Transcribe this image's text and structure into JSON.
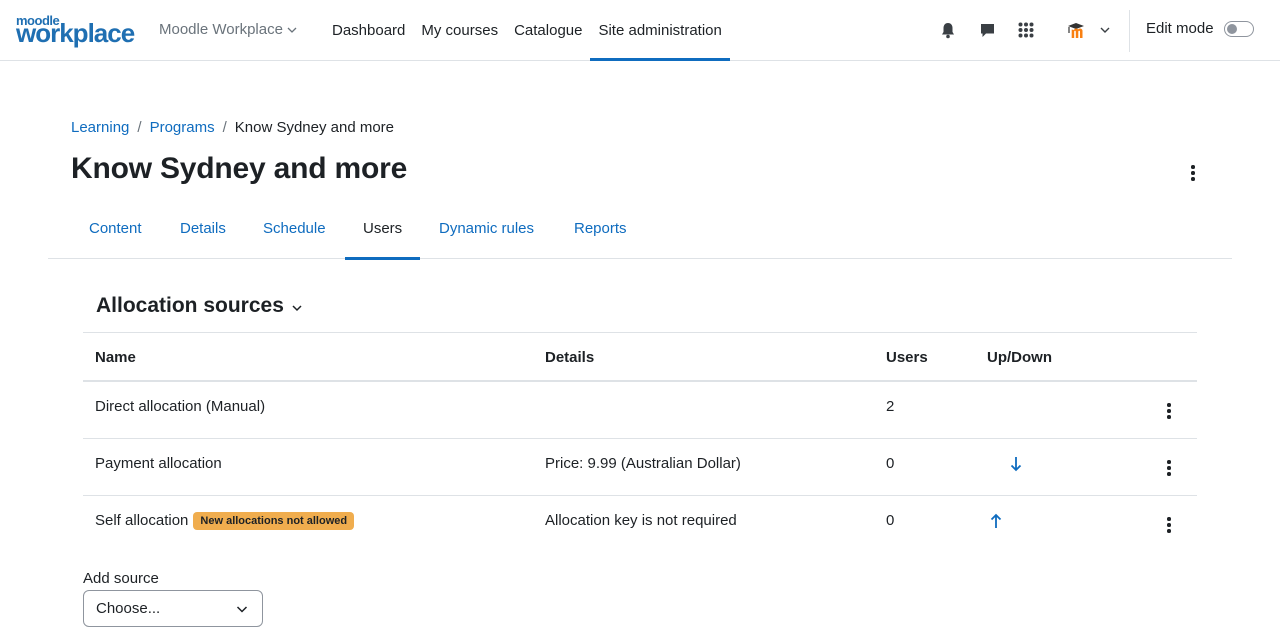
{
  "navbar": {
    "logo_top": "moodle",
    "logo_bottom": "workplace",
    "site_switch": "Moodle Workplace",
    "items": [
      {
        "label": "Dashboard"
      },
      {
        "label": "My courses"
      },
      {
        "label": "Catalogue"
      },
      {
        "label": "Site administration"
      }
    ],
    "active_item": "Site administration",
    "edit_mode_label": "Edit mode",
    "edit_mode_on": false
  },
  "breadcrumb": {
    "items": [
      "Learning",
      "Programs"
    ],
    "current": "Know Sydney and more"
  },
  "page": {
    "title": "Know Sydney and more"
  },
  "tabs": [
    {
      "label": "Content"
    },
    {
      "label": "Details"
    },
    {
      "label": "Schedule"
    },
    {
      "label": "Users"
    },
    {
      "label": "Dynamic rules"
    },
    {
      "label": "Reports"
    }
  ],
  "active_tab": "Users",
  "section": {
    "title": "Allocation sources"
  },
  "table": {
    "headers": {
      "name": "Name",
      "details": "Details",
      "users": "Users",
      "updown": "Up/Down"
    },
    "rows": [
      {
        "name": "Direct allocation (Manual)",
        "badge": "",
        "details": "",
        "users": "2",
        "arrow": ""
      },
      {
        "name": "Payment allocation",
        "badge": "",
        "details": "Price: 9.99 (Australian Dollar)",
        "users": "0",
        "arrow": "down"
      },
      {
        "name": "Self allocation",
        "badge": "New allocations not allowed",
        "details": "Allocation key is not required",
        "users": "0",
        "arrow": "up"
      }
    ]
  },
  "add_source": {
    "label": "Add source",
    "selected": "Choose..."
  },
  "colors": {
    "link": "#0f6cbf",
    "badge_warning": "#f0ad4e",
    "brand_orange": "#f98012"
  }
}
